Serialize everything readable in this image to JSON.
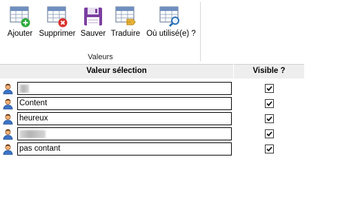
{
  "ribbon": {
    "buttons": [
      {
        "id": "ajouter",
        "label": "Ajouter",
        "icon": "table-add-icon"
      },
      {
        "id": "supprimer",
        "label": "Supprimer",
        "icon": "table-delete-icon"
      },
      {
        "id": "sauver",
        "label": "Sauver",
        "icon": "floppy-save-icon"
      },
      {
        "id": "traduire",
        "label": "Traduire",
        "icon": "table-translate-icon"
      },
      {
        "id": "ou-utilise",
        "label": "Où utilisé(e) ?",
        "icon": "table-search-icon"
      }
    ],
    "group_label": "Valeurs"
  },
  "grid": {
    "headers": {
      "value": "Valeur sélection",
      "visible": "Visible ?"
    },
    "rows": [
      {
        "value": "",
        "redacted": true,
        "visible": true,
        "icon": "user-icon"
      },
      {
        "value": "Content",
        "redacted": false,
        "visible": true,
        "icon": "user-icon"
      },
      {
        "value": "heureux",
        "redacted": false,
        "visible": true,
        "icon": "user-icon"
      },
      {
        "value": "",
        "redacted": true,
        "visible": true,
        "icon": "user-icon"
      },
      {
        "value": "pas contant",
        "redacted": false,
        "visible": true,
        "icon": "user-icon"
      }
    ]
  },
  "colors": {
    "header_bg": "#eeeeee",
    "save_icon": "#7b3fa0",
    "add_badge": "#2eaa3c",
    "delete_badge": "#d8322c"
  }
}
